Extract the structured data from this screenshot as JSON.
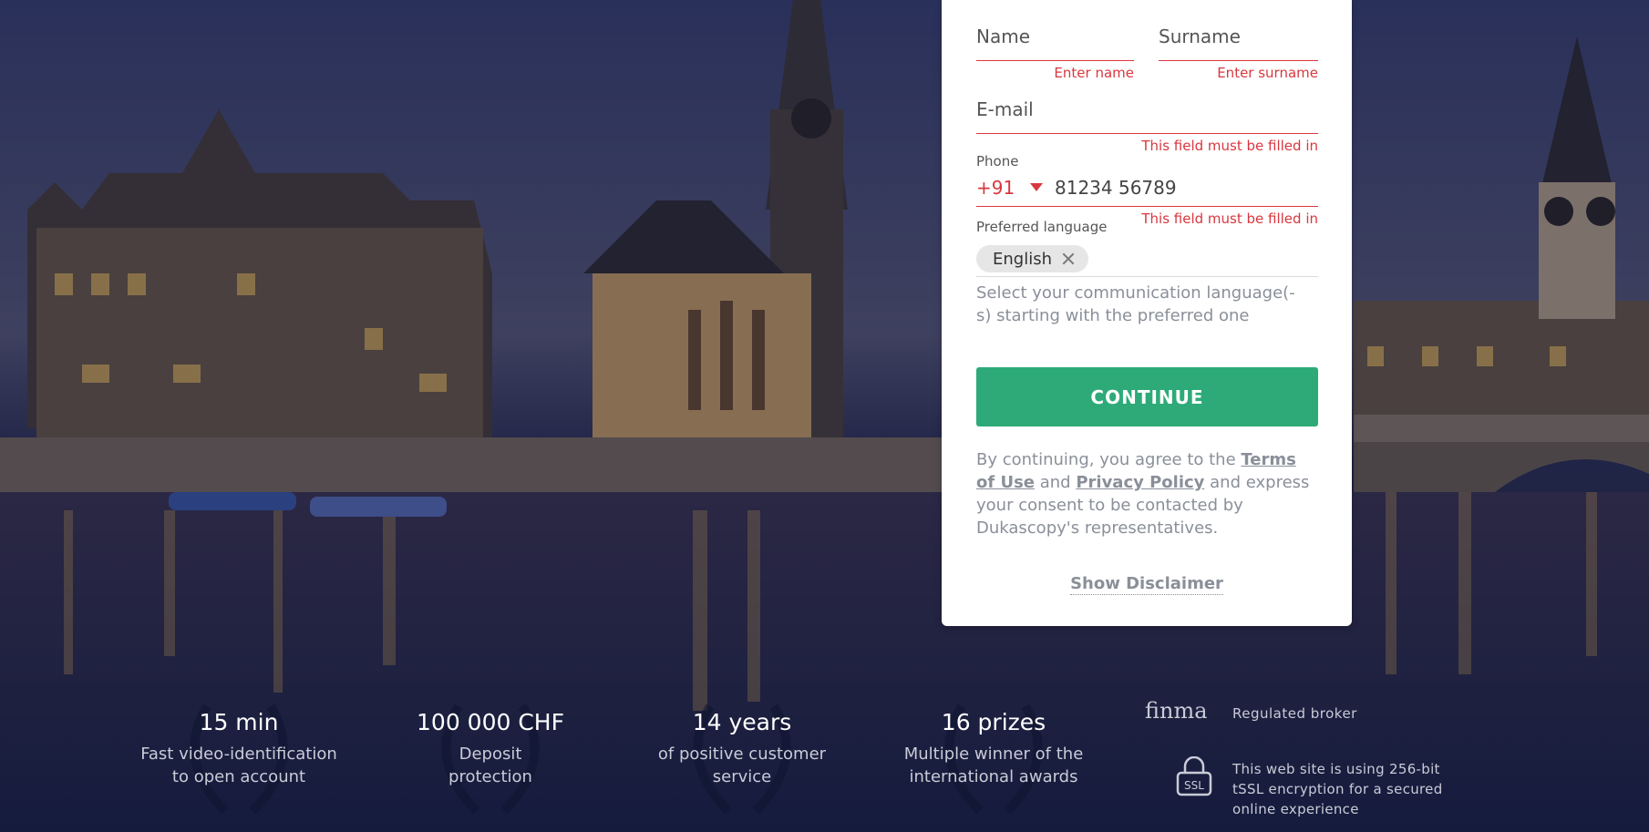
{
  "form": {
    "name_placeholder": "Name",
    "surname_placeholder": "Surname",
    "name_error": "Enter name",
    "surname_error": "Enter surname",
    "email_placeholder": "E-mail",
    "email_error": "This field must be filled in",
    "phone_label": "Phone",
    "phone_code": "+91",
    "phone_number": "81234 56789",
    "phone_error": "This field must be filled in",
    "language_label": "Preferred language",
    "language_chip": "English",
    "language_hint": "Select your communication language(-s) starting with the preferred one",
    "continue_label": "CONTINUE",
    "legal_prefix": "By continuing, you agree to the ",
    "terms_link": "Terms of Use",
    "legal_and": " and ",
    "privacy_link": "Privacy Policy",
    "legal_suffix": " and express your consent to be contacted by Dukascopy's representatives.",
    "disclaimer_link": "Show Disclaimer"
  },
  "stats": [
    {
      "value": "15 min",
      "text": "Fast video-identification to open account"
    },
    {
      "value": "100 000 CHF",
      "text": "Deposit protection"
    },
    {
      "value": "14 years",
      "text": "of positive customer service"
    },
    {
      "value": "16 prizes",
      "text": "Multiple winner of the international awards"
    }
  ],
  "badges": {
    "finma": "finma",
    "regulated": "Regulated broker",
    "ssl_icon_text": "SSL",
    "ssl_text": "This web site is using 256-bit tSSL encryption for a secured online experience"
  },
  "colors": {
    "accent_green": "#2eaa78",
    "error_red": "#d9373e"
  }
}
